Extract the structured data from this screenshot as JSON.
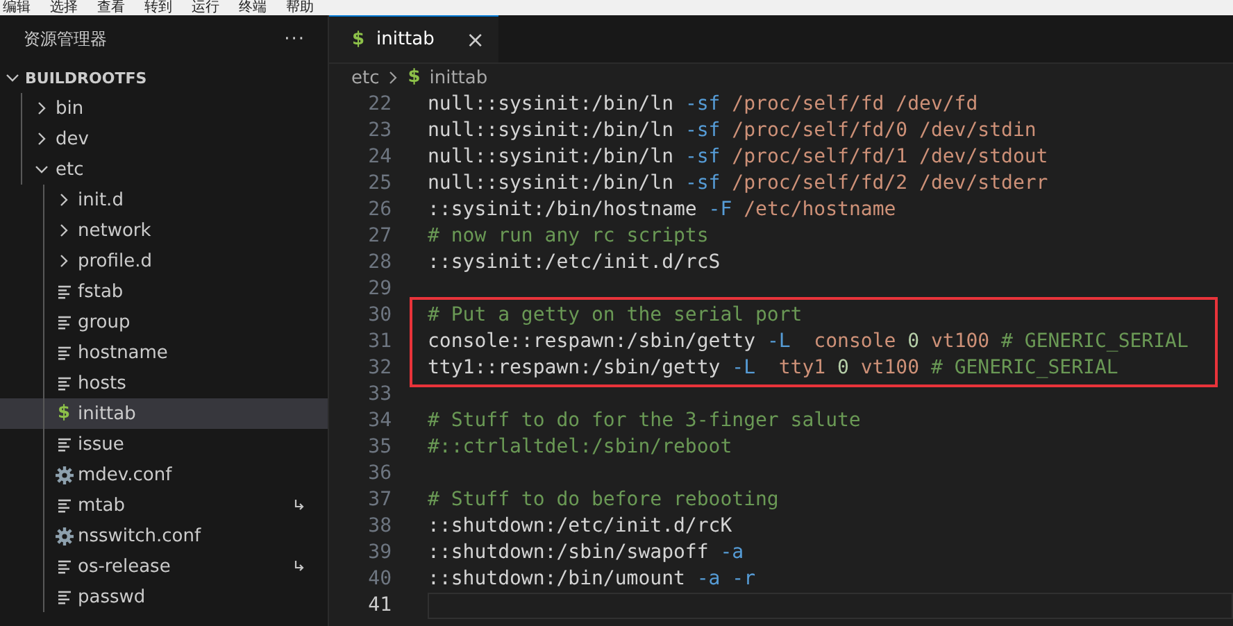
{
  "menu_bar": [
    "编辑",
    "选择",
    "查看",
    "转到",
    "运行",
    "终端",
    "帮助"
  ],
  "sidebar": {
    "title": "资源管理器",
    "more": "···",
    "root": {
      "label": "BUILDROOTFS",
      "expanded": true
    },
    "items": [
      {
        "kind": "folder",
        "label": "bin",
        "expanded": false
      },
      {
        "kind": "folder",
        "label": "dev",
        "expanded": false
      },
      {
        "kind": "folder",
        "label": "etc",
        "expanded": true,
        "children": [
          {
            "kind": "folder",
            "label": "init.d",
            "expanded": false
          },
          {
            "kind": "folder",
            "label": "network",
            "expanded": false
          },
          {
            "kind": "folder",
            "label": "profile.d",
            "expanded": false
          },
          {
            "kind": "text",
            "label": "fstab",
            "selected": false,
            "symlink": false
          },
          {
            "kind": "text",
            "label": "group",
            "selected": false,
            "symlink": false
          },
          {
            "kind": "text",
            "label": "hostname",
            "selected": false,
            "symlink": false
          },
          {
            "kind": "text",
            "label": "hosts",
            "selected": false,
            "symlink": false
          },
          {
            "kind": "script",
            "icon": "$",
            "label": "inittab",
            "selected": true,
            "symlink": false
          },
          {
            "kind": "text",
            "label": "issue",
            "selected": false,
            "symlink": false
          },
          {
            "kind": "config",
            "label": "mdev.conf",
            "selected": false,
            "symlink": false
          },
          {
            "kind": "text",
            "label": "mtab",
            "selected": false,
            "symlink": true
          },
          {
            "kind": "config",
            "label": "nsswitch.conf",
            "selected": false,
            "symlink": false
          },
          {
            "kind": "text",
            "label": "os-release",
            "selected": false,
            "symlink": true
          },
          {
            "kind": "text",
            "label": "passwd",
            "selected": false,
            "symlink": false
          }
        ]
      }
    ]
  },
  "tabs": [
    {
      "icon": "$",
      "label": "inittab",
      "selected": true,
      "close": "×"
    }
  ],
  "breadcrumb": [
    {
      "label": "etc"
    },
    {
      "icon": "$",
      "label": "inittab"
    }
  ],
  "editor": {
    "lines": [
      {
        "number": "22",
        "highlighted": false,
        "current": false,
        "tokens": [
          {
            "kind": "plain",
            "text": "null::sysinit:/bin/ln"
          },
          {
            "kind": "flag",
            "text": " -sf"
          },
          {
            "kind": "string",
            "text": " /proc/self/fd /dev/fd"
          }
        ]
      },
      {
        "number": "23",
        "highlighted": false,
        "current": false,
        "tokens": [
          {
            "kind": "plain",
            "text": "null::sysinit:/bin/ln"
          },
          {
            "kind": "flag",
            "text": " -sf"
          },
          {
            "kind": "string",
            "text": " /proc/self/fd/0 /dev/stdin"
          }
        ]
      },
      {
        "number": "24",
        "highlighted": false,
        "current": false,
        "tokens": [
          {
            "kind": "plain",
            "text": "null::sysinit:/bin/ln"
          },
          {
            "kind": "flag",
            "text": " -sf"
          },
          {
            "kind": "string",
            "text": " /proc/self/fd/1 /dev/stdout"
          }
        ]
      },
      {
        "number": "25",
        "highlighted": false,
        "current": false,
        "tokens": [
          {
            "kind": "plain",
            "text": "null::sysinit:/bin/ln"
          },
          {
            "kind": "flag",
            "text": " -sf"
          },
          {
            "kind": "string",
            "text": " /proc/self/fd/2 /dev/stderr"
          }
        ]
      },
      {
        "number": "26",
        "highlighted": false,
        "current": false,
        "tokens": [
          {
            "kind": "plain",
            "text": "::sysinit:/bin/hostname"
          },
          {
            "kind": "flag",
            "text": " -F"
          },
          {
            "kind": "string",
            "text": " /etc/hostname"
          }
        ]
      },
      {
        "number": "27",
        "highlighted": false,
        "current": false,
        "tokens": [
          {
            "kind": "comment",
            "text": "# now run any rc scripts"
          }
        ]
      },
      {
        "number": "28",
        "highlighted": false,
        "current": false,
        "tokens": [
          {
            "kind": "plain",
            "text": "::sysinit:/etc/init.d/rcS"
          }
        ]
      },
      {
        "number": "29",
        "highlighted": false,
        "current": false
      },
      {
        "number": "30",
        "highlighted": true,
        "current": false,
        "tokens": [
          {
            "kind": "comment",
            "text": "# Put a getty on the serial port"
          }
        ]
      },
      {
        "number": "31",
        "highlighted": true,
        "current": false,
        "tokens": [
          {
            "kind": "plain",
            "text": "console::respawn:/sbin/getty"
          },
          {
            "kind": "flag",
            "text": " -L"
          },
          {
            "kind": "string",
            "text": "  console"
          },
          {
            "kind": "number",
            "text": " 0"
          },
          {
            "kind": "string",
            "text": " vt100"
          },
          {
            "kind": "comment",
            "text": " # GENERIC_SERIAL"
          }
        ]
      },
      {
        "number": "32",
        "highlighted": true,
        "current": false,
        "tokens": [
          {
            "kind": "plain",
            "text": "tty1::respawn:/sbin/getty"
          },
          {
            "kind": "flag",
            "text": " -L"
          },
          {
            "kind": "string",
            "text": "  tty1"
          },
          {
            "kind": "number",
            "text": " 0"
          },
          {
            "kind": "string",
            "text": " vt100"
          },
          {
            "kind": "comment",
            "text": " # GENERIC_SERIAL"
          }
        ]
      },
      {
        "number": "33",
        "highlighted": false,
        "current": false
      },
      {
        "number": "34",
        "highlighted": false,
        "current": false,
        "tokens": [
          {
            "kind": "comment",
            "text": "# Stuff to do for the 3-finger salute"
          }
        ]
      },
      {
        "number": "35",
        "highlighted": false,
        "current": false,
        "tokens": [
          {
            "kind": "comment",
            "text": "#::ctrlaltdel:/sbin/reboot"
          }
        ]
      },
      {
        "number": "36",
        "highlighted": false,
        "current": false
      },
      {
        "number": "37",
        "highlighted": false,
        "current": false,
        "tokens": [
          {
            "kind": "comment",
            "text": "# Stuff to do before rebooting"
          }
        ]
      },
      {
        "number": "38",
        "highlighted": false,
        "current": false,
        "tokens": [
          {
            "kind": "plain",
            "text": "::shutdown:/etc/init.d/rcK"
          }
        ]
      },
      {
        "number": "39",
        "highlighted": false,
        "current": false,
        "tokens": [
          {
            "kind": "plain",
            "text": "::shutdown:/sbin/swapoff"
          },
          {
            "kind": "flag",
            "text": " -a"
          }
        ]
      },
      {
        "number": "40",
        "highlighted": false,
        "current": false,
        "tokens": [
          {
            "kind": "plain",
            "text": "::shutdown:/bin/umount"
          },
          {
            "kind": "flag",
            "text": " -a -r"
          }
        ]
      },
      {
        "number": "41",
        "highlighted": false,
        "current": true
      }
    ]
  }
}
